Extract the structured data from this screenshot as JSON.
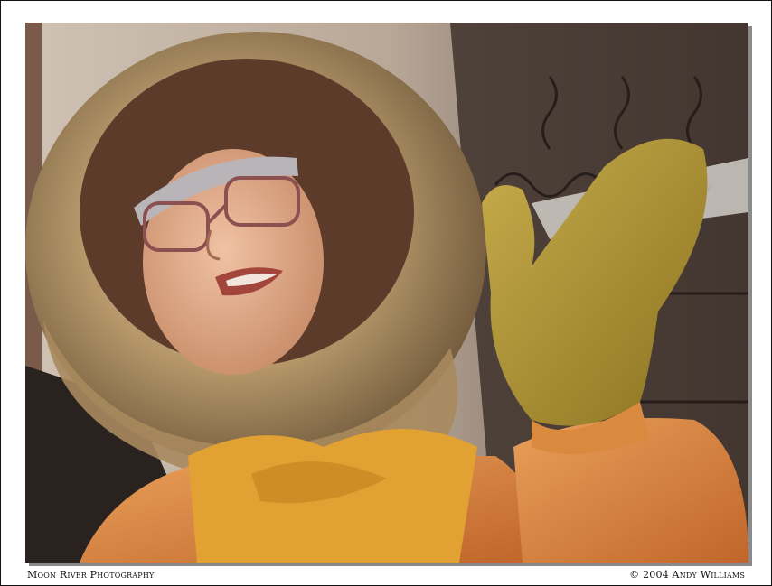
{
  "caption": {
    "left": "Moon River Photography",
    "right": "© 2004 Andy Williams"
  },
  "colors": {
    "frame_border": "#111111",
    "background": "#ffffff",
    "fur": "#b89a6a",
    "scarf": "#e2a233",
    "coat": "#d9823a",
    "mitten": "#b59a3a"
  }
}
